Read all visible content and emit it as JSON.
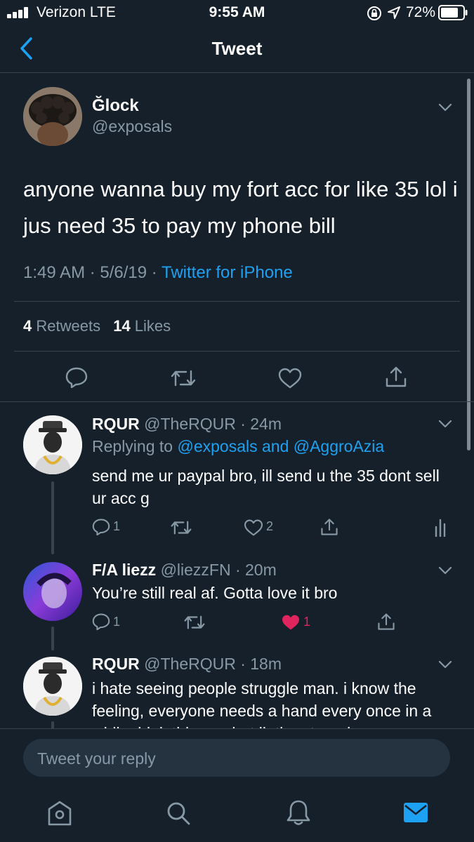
{
  "status_bar": {
    "carrier": "Verizon  LTE",
    "time": "9:55 AM",
    "battery": "72%"
  },
  "header": {
    "title": "Tweet"
  },
  "tweet": {
    "display_name": "Ğlock",
    "handle": "@exposals",
    "text": "anyone wanna buy my fort acc for like 35 lol i jus need 35 to pay my phone bill",
    "time": "1:49 AM · 5/6/19 · ",
    "source": "Twitter for iPhone",
    "retweets_count": "4",
    "retweets_label": " Retweets",
    "likes_count": "14",
    "likes_label": " Likes"
  },
  "replies": [
    {
      "display_name": "RQUR",
      "handle_time": "@TheRQUR · 24m",
      "replying_prefix": "Replying to ",
      "replying_to": "@exposals and @AggroAzia",
      "text": "send me ur paypal bro, ill send u the 35 dont sell ur acc g",
      "reply_count": "1",
      "like_count": "2"
    },
    {
      "display_name": "F/A liezz",
      "handle_time": "@liezzFN · 20m",
      "text": "You’re still real af. Gotta love it bro",
      "reply_count": "1",
      "like_count": "1",
      "liked": true
    },
    {
      "display_name": "RQUR",
      "handle_time": "@TheRQUR · 18m",
      "text": "i hate seeing people struggle man. i know the feeling, everyone needs a hand every once in a while. idek this guy but ik the struggle man"
    }
  ],
  "composer": {
    "placeholder": "Tweet your reply"
  },
  "colors": {
    "background": "#15202b",
    "accent": "#1da1f2",
    "like": "#e0245e",
    "muted": "#8899a6"
  }
}
